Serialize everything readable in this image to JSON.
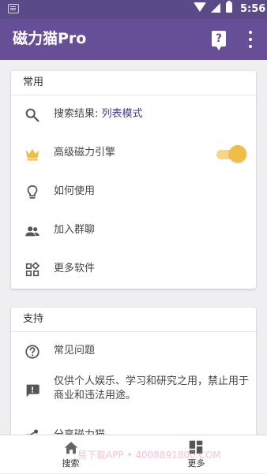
{
  "statusbar": {
    "time": "5:56",
    "icons": [
      "keyboard-icon",
      "wifi-icon",
      "signal-icon",
      "battery-icon"
    ]
  },
  "appbar": {
    "title": "磁力猫Pro",
    "help_icon_glyph": "?",
    "icons": [
      "help-icon",
      "more-vert-icon"
    ]
  },
  "sections": {
    "common": {
      "header": "常用",
      "search_label": "搜索结果:",
      "search_value": "列表模式",
      "advanced_label": "高级磁力引擎",
      "advanced_enabled": true,
      "howto_label": "如何使用",
      "join_group_label": "加入群聊",
      "more_apps_label": "更多软件"
    },
    "support": {
      "header": "支持",
      "faq_label": "常见问题",
      "disclaimer_line1": "仅供个人娱乐、学习和研究之用，禁止用于",
      "disclaimer_line2": "商业和违法用途。",
      "share_label": "分享磁力猫"
    }
  },
  "bottom_nav": {
    "items": [
      {
        "label": "搜索",
        "icon": "home-icon"
      },
      {
        "label": "更多",
        "icon": "dashboard-icon",
        "selected": true
      }
    ]
  },
  "colors": {
    "status_bar": "#5a4a88",
    "app_bar": "#674f98",
    "accent": "#efbe43",
    "link": "#4d3a88",
    "icon": "#555555"
  },
  "watermark": "易下载APP • 4008891800.COM"
}
